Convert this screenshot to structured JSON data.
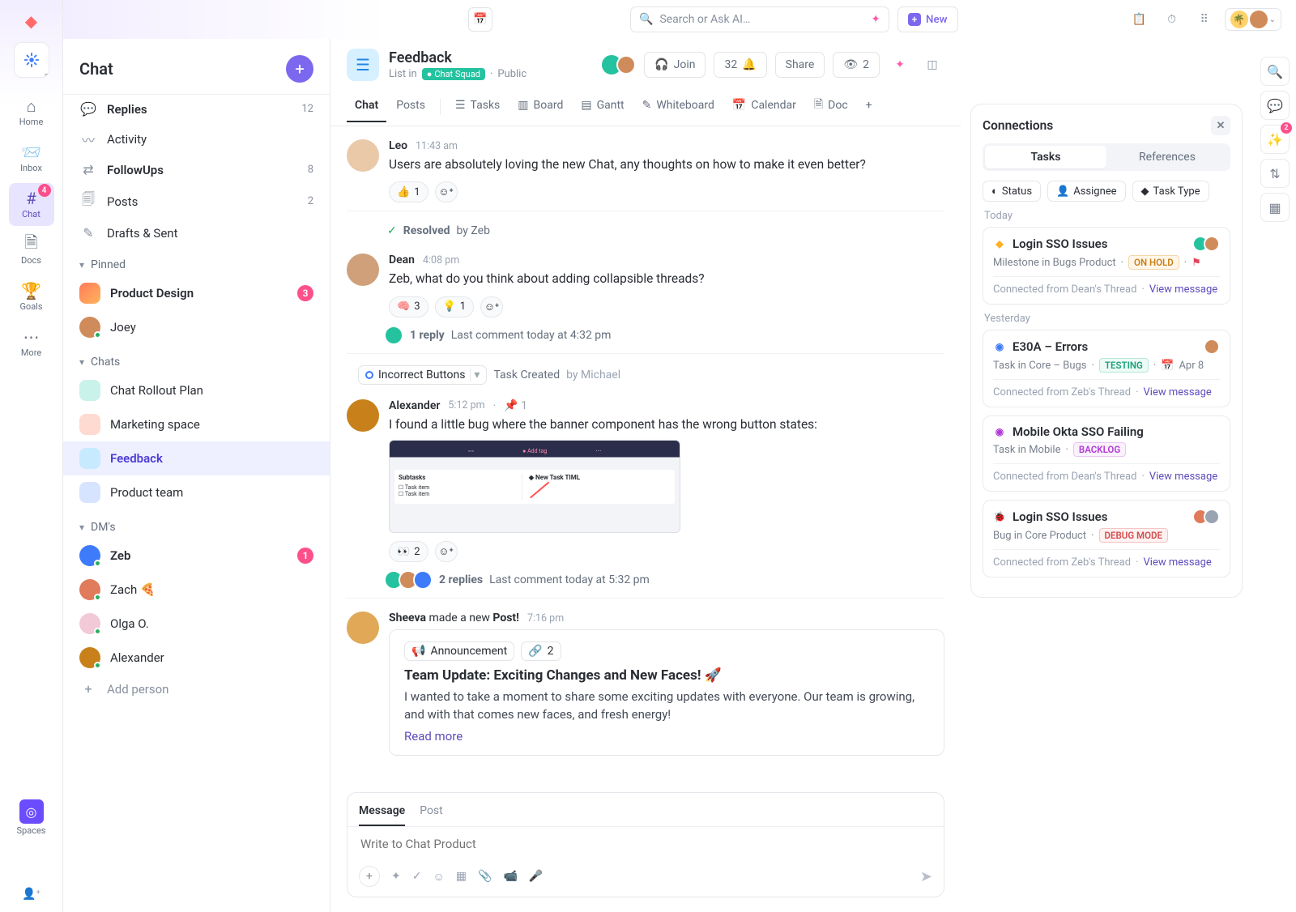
{
  "topbar": {
    "search_placeholder": "Search or Ask AI…",
    "new_label": "New"
  },
  "rail": {
    "items": [
      {
        "label": "Home"
      },
      {
        "label": "Inbox"
      },
      {
        "label": "Chat",
        "badge": "4"
      },
      {
        "label": "Docs"
      },
      {
        "label": "Goals"
      },
      {
        "label": "More"
      }
    ],
    "spaces_label": "Spaces"
  },
  "chatpanel": {
    "title": "Chat",
    "top": [
      {
        "label": "Replies",
        "count": "12"
      },
      {
        "label": "Activity"
      },
      {
        "label": "FollowUps",
        "count": "8"
      },
      {
        "label": "Posts",
        "count": "2"
      },
      {
        "label": "Drafts & Sent"
      }
    ],
    "pinned_title": "Pinned",
    "pinned": [
      {
        "label": "Product Design",
        "badge": "3"
      },
      {
        "label": "Joey"
      }
    ],
    "chats_title": "Chats",
    "chats": [
      {
        "label": "Chat Rollout Plan"
      },
      {
        "label": "Marketing space"
      },
      {
        "label": "Feedback"
      },
      {
        "label": "Product team"
      }
    ],
    "dms_title": "DM's",
    "dms": [
      {
        "label": "Zeb",
        "badge": "1"
      },
      {
        "label": "Zach"
      },
      {
        "label": "Olga O."
      },
      {
        "label": "Alexander"
      }
    ],
    "add_person": "Add person"
  },
  "header": {
    "title": "Feedback",
    "sub_list": "List in",
    "squad": "Chat Squad",
    "visibility": "Public",
    "join": "Join",
    "count": "32",
    "share": "Share",
    "watchers": "2"
  },
  "views": [
    {
      "label": "Chat"
    },
    {
      "label": "Posts"
    },
    {
      "label": "Tasks"
    },
    {
      "label": "Board"
    },
    {
      "label": "Gantt"
    },
    {
      "label": "Whiteboard"
    },
    {
      "label": "Calendar"
    },
    {
      "label": "Doc"
    }
  ],
  "messages": [
    {
      "name": "Leo",
      "time": "11:43 am",
      "text": "Users are absolutely loving the new Chat, any thoughts on how to make it even better?",
      "react": [
        [
          "👍",
          "1"
        ]
      ]
    },
    {
      "resolved_label": "Resolved",
      "resolved_by": "by Zeb",
      "name": "Dean",
      "time": "4:08 pm",
      "text": "Zeb, what do you think about adding collapsible threads?",
      "react": [
        [
          "🧠",
          "3"
        ],
        [
          "💡",
          "1"
        ]
      ],
      "reply": "1 reply",
      "reply_meta": "Last comment today at 4:32 pm"
    },
    {
      "task": "Incorrect Buttons",
      "task_meta": "Task Created",
      "task_by": "by Michael",
      "name": "Alexander",
      "time": "5:12 pm",
      "pinned": "1",
      "text": "I found a little bug where the banner component has the wrong button states:",
      "react": [
        [
          "👀",
          "2"
        ]
      ],
      "reply": "2 replies",
      "reply_meta": "Last comment today at 5:32 pm"
    },
    {
      "name": "Sheeva",
      "post_made": "made a new",
      "post_word": "Post!",
      "time": "7:16 pm",
      "post": {
        "ann": "Announcement",
        "att": "2",
        "title": "Team Update: Exciting Changes and New Faces! 🚀",
        "body": "I wanted to take a moment to share some exciting updates with everyone. Our team is growing, and with that comes new faces, and fresh energy!",
        "readmore": "Read more"
      }
    }
  ],
  "composer": {
    "tab_msg": "Message",
    "tab_post": "Post",
    "placeholder": "Write to Chat Product"
  },
  "connections": {
    "title": "Connections",
    "tabs": {
      "tasks": "Tasks",
      "refs": "References"
    },
    "filters": [
      {
        "label": "Status"
      },
      {
        "label": "Assignee"
      },
      {
        "label": "Task Type"
      }
    ],
    "groups": [
      {
        "label": "Today",
        "items": [
          {
            "title": "Login SSO Issues",
            "sub": "Milestone in Bugs Product",
            "tag": "ON HOLD",
            "tag_class": "hold",
            "flag": true,
            "from": "Connected from Dean's Thread",
            "link": "View message",
            "avs": 2
          }
        ]
      },
      {
        "label": "Yesterday",
        "items": [
          {
            "title": "E30A – Errors",
            "sub": "Task in Core – Bugs",
            "tag": "TESTING",
            "tag_class": "test",
            "date": "Apr 8",
            "from": "Connected from Zeb's Thread",
            "link": "View message",
            "avs": 1
          },
          {
            "title": "Mobile Okta SSO Failing",
            "sub": "Task in Mobile",
            "tag": "BACKLOG",
            "tag_class": "back",
            "from": "Connected from Dean's Thread",
            "link": "View message"
          },
          {
            "title": "Login SSO Issues",
            "sub": "Bug in Core Product",
            "tag": "DEBUG MODE",
            "tag_class": "debug",
            "from": "Connected from Zeb's Thread",
            "link": "View message",
            "avs": 2,
            "bugicon": true
          }
        ]
      }
    ]
  }
}
